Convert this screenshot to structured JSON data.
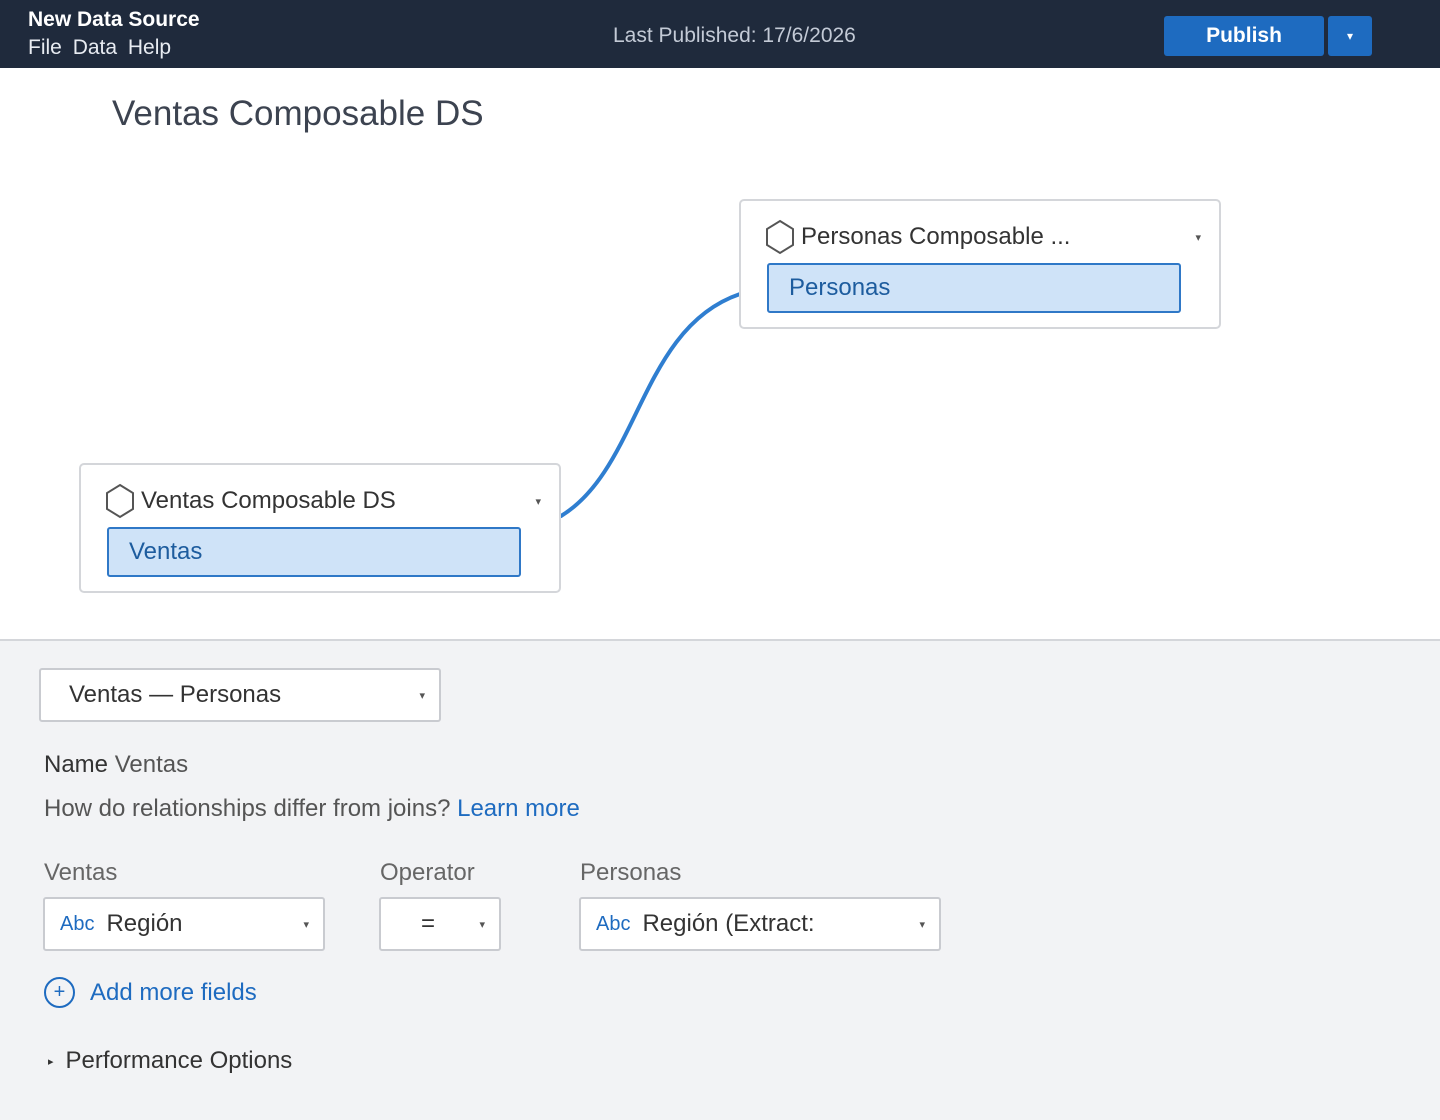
{
  "header": {
    "app_title": "New Data Source",
    "menu": [
      "File",
      "Data",
      "Help"
    ],
    "last_published": "Last Published: 17/6/2026",
    "publish_label": "Publish",
    "publish_caret": "▾"
  },
  "canvas": {
    "title": "Ventas Composable DS",
    "cards": {
      "ventas": {
        "name": "Ventas Composable DS",
        "table": "Ventas",
        "caret": "▾"
      },
      "personas": {
        "name": "Personas Composable ...",
        "table": "Personas",
        "caret": "▾"
      }
    },
    "colors": {
      "connector": "#2f7ed0",
      "chip_bg": "#cfe3f8",
      "chip_border": "#2f78c7"
    }
  },
  "panel": {
    "relationship_select": "Ventas — Personas",
    "name_label": "Name",
    "name_value": "Ventas",
    "question": "How do relationships differ from joins?",
    "learn_more": "Learn more",
    "left_label": "Ventas",
    "operator_label": "Operator",
    "right_label": "Personas",
    "left_field": {
      "type": "Abc",
      "value": "Región"
    },
    "operator_value": "=",
    "right_field": {
      "type": "Abc",
      "value": "Región (Extract:"
    },
    "add_more": "Add more fields",
    "add_icon": "+",
    "performance": "Performance Options",
    "performance_arrow": "▸",
    "caret": "▾"
  }
}
